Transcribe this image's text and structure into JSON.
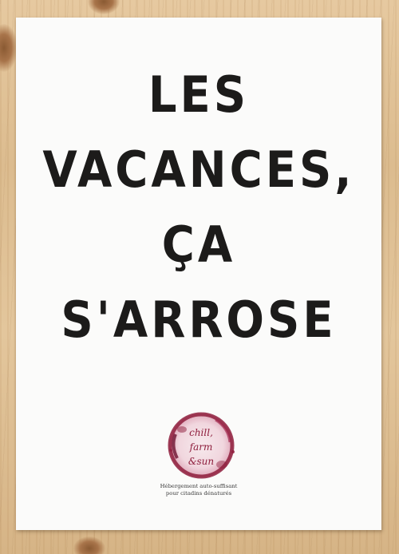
{
  "poster": {
    "headline_lines": [
      "LES",
      "VACANCES,",
      "ÇA",
      "S'ARROSE"
    ],
    "logo_text": "chill, farm & sun",
    "tagline_lines": [
      "Hébergement auto-suffisant",
      "pour citadins dénaturés"
    ]
  },
  "colors": {
    "ink": "#1c1b1a",
    "paper": "#fbfbfa",
    "wine_stain": "#8e1d3c",
    "wood": "#e0c39a"
  }
}
